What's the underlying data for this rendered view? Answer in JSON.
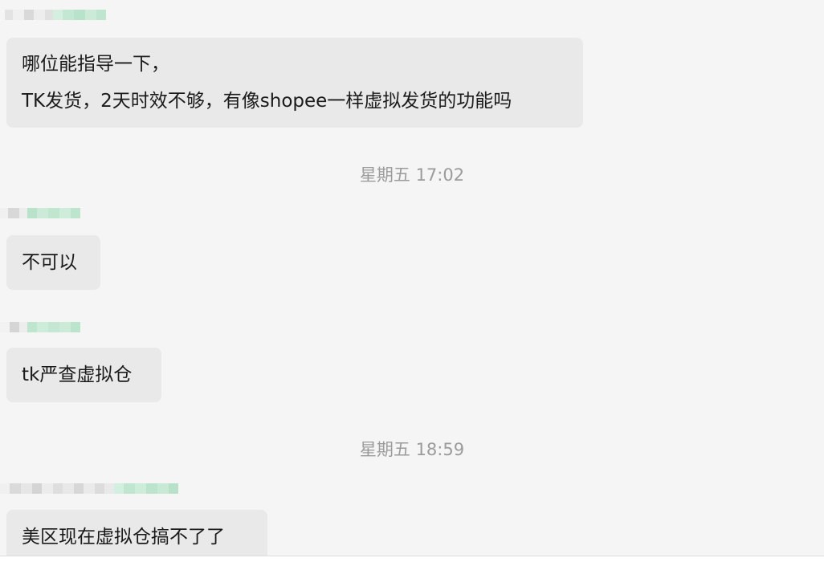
{
  "colors": {
    "background": "#f5f5f5",
    "bubble": "#e9e9e9",
    "text": "#1a1a1a",
    "timestamp": "#9b9b9b",
    "name_blur_gray": "#d6d6d6",
    "name_blur_green": "#c8ead6"
  },
  "messages": [
    {
      "lines": [
        "哪位能指导一下，",
        "TK发货，2天时效不够，有像shopee一样虚拟发货的功能吗"
      ]
    },
    {
      "time": "星期五 17:02",
      "lines": [
        "不可以"
      ]
    },
    {
      "lines": [
        "tk严查虚拟仓"
      ]
    },
    {
      "time": "星期五 18:59",
      "lines": [
        "美区现在虚拟仓搞不了了"
      ]
    }
  ]
}
